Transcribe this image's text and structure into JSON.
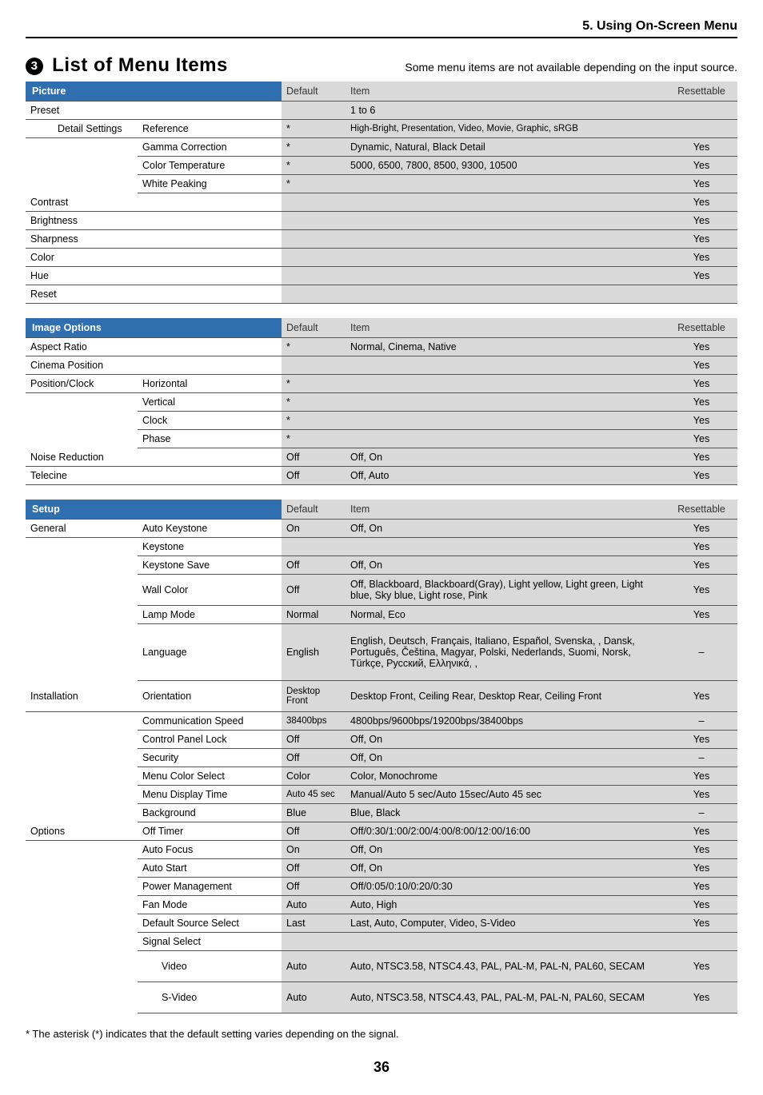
{
  "header": {
    "section": "5. Using On-Screen Menu",
    "bullet": "3",
    "title": "List of Menu Items",
    "subtitle": "Some menu items are not available depending on the input source."
  },
  "columns": {
    "default": "Default",
    "item": "Item",
    "resettable": "Resettable"
  },
  "tables": {
    "picture": {
      "tab": "Picture",
      "rows": [
        {
          "c1": "Preset",
          "c2": "",
          "def": "",
          "item": "1 to 6",
          "res": ""
        },
        {
          "c1": "Detail Settings",
          "c2": "Reference",
          "def": "*",
          "item": "High-Bright, Presentation, Video, Movie, Graphic, sRGB",
          "res": "",
          "indent1": true,
          "small": true
        },
        {
          "c1": "",
          "c2": "Gamma Correction",
          "def": "*",
          "item": "Dynamic, Natural, Black Detail",
          "res": "Yes"
        },
        {
          "c1": "",
          "c2": "Color Temperature",
          "def": "*",
          "item": "5000, 6500, 7800, 8500, 9300, 10500",
          "res": "Yes"
        },
        {
          "c1": "",
          "c2": "White Peaking",
          "def": "*",
          "item": "",
          "res": "Yes"
        },
        {
          "c1": "Contrast",
          "c2": "",
          "def": "",
          "item": "",
          "res": "Yes"
        },
        {
          "c1": "Brightness",
          "c2": "",
          "def": "",
          "item": "",
          "res": "Yes"
        },
        {
          "c1": "Sharpness",
          "c2": "",
          "def": "",
          "item": "",
          "res": "Yes"
        },
        {
          "c1": "Color",
          "c2": "",
          "def": "",
          "item": "",
          "res": "Yes"
        },
        {
          "c1": "Hue",
          "c2": "",
          "def": "",
          "item": "",
          "res": "Yes"
        },
        {
          "c1": "Reset",
          "c2": "",
          "def": "",
          "item": "",
          "res": ""
        }
      ]
    },
    "image": {
      "tab": "Image Options",
      "rows": [
        {
          "c1": "Aspect Ratio",
          "c2": "",
          "def": "*",
          "item": "Normal, Cinema, Native",
          "res": "Yes"
        },
        {
          "c1": "Cinema Position",
          "c2": "",
          "def": "",
          "item": "",
          "res": "Yes"
        },
        {
          "c1": "Position/Clock",
          "c2": "Horizontal",
          "def": "*",
          "item": "",
          "res": "Yes"
        },
        {
          "c1": "",
          "c2": "Vertical",
          "def": "*",
          "item": "",
          "res": "Yes"
        },
        {
          "c1": "",
          "c2": "Clock",
          "def": "*",
          "item": "",
          "res": "Yes"
        },
        {
          "c1": "",
          "c2": "Phase",
          "def": "*",
          "item": "",
          "res": "Yes"
        },
        {
          "c1": "Noise Reduction",
          "c2": "",
          "def": "Off",
          "item": "Off, On",
          "res": "Yes"
        },
        {
          "c1": "Telecine",
          "c2": "",
          "def": "Off",
          "item": "Off, Auto",
          "res": "Yes"
        }
      ]
    },
    "setup": {
      "tab": "Setup",
      "rows": [
        {
          "c1": "General",
          "c2": "Auto Keystone",
          "def": "On",
          "item": "Off, On",
          "res": "Yes"
        },
        {
          "c1": "",
          "c2": "Keystone",
          "def": "",
          "item": "",
          "res": "Yes"
        },
        {
          "c1": "",
          "c2": "Keystone Save",
          "def": "Off",
          "item": "Off, On",
          "res": "Yes"
        },
        {
          "c1": "",
          "c2": "Wall Color",
          "def": "Off",
          "item": "Off, Blackboard, Blackboard(Gray), Light yellow, Light green, Light blue, Sky blue, Light rose, Pink",
          "res": "Yes",
          "tall": true
        },
        {
          "c1": "",
          "c2": "Lamp Mode",
          "def": "Normal",
          "item": "Normal, Eco",
          "res": "Yes"
        },
        {
          "c1": "",
          "c2": "Language",
          "def": "English",
          "item": "English, Deutsch, Français, Italiano, Español, Svenska,            , Dansk, Português, Čeština, Magyar, Polski, Nederlands, Suomi, Norsk, Türkçe, Русский, Еλληνικά,       ,",
          "res": "–",
          "tall4": true
        },
        {
          "c1": "Installation",
          "c2": "Orientation",
          "def": "Desktop Front",
          "defsmall": true,
          "item": "Desktop Front, Ceiling Rear, Desktop Rear, Ceiling Front",
          "res": "Yes",
          "tall": true
        },
        {
          "c1": "",
          "c2": "Communication Speed",
          "def": "38400bps",
          "defsmall": true,
          "item": "4800bps/9600bps/19200bps/38400bps",
          "res": "–"
        },
        {
          "c1": "",
          "c2": "Control Panel Lock",
          "def": "Off",
          "item": "Off, On",
          "res": "Yes"
        },
        {
          "c1": "",
          "c2": "Security",
          "def": "Off",
          "item": "Off, On",
          "res": "–"
        },
        {
          "c1": "",
          "c2": "Menu Color Select",
          "def": "Color",
          "item": "Color, Monochrome",
          "res": "Yes"
        },
        {
          "c1": "",
          "c2": "Menu Display Time",
          "def": "Auto 45 sec",
          "defsmall": true,
          "item": "Manual/Auto 5 sec/Auto 15sec/Auto 45 sec",
          "res": "Yes"
        },
        {
          "c1": "",
          "c2": "Background",
          "def": "Blue",
          "item": "Blue, Black",
          "res": "–"
        },
        {
          "c1": "Options",
          "c2": "Off Timer",
          "def": "Off",
          "item": "Off/0:30/1:00/2:00/4:00/8:00/12:00/16:00",
          "res": "Yes"
        },
        {
          "c1": "",
          "c2": "Auto Focus",
          "def": "On",
          "item": "Off, On",
          "res": "Yes"
        },
        {
          "c1": "",
          "c2": "Auto Start",
          "def": "Off",
          "item": "Off, On",
          "res": "Yes"
        },
        {
          "c1": "",
          "c2": "Power Management",
          "def": "Off",
          "item": "Off/0:05/0:10/0:20/0:30",
          "res": "Yes"
        },
        {
          "c1": "",
          "c2": "Fan Mode",
          "def": "Auto",
          "item": "Auto, High",
          "res": "Yes"
        },
        {
          "c1": "",
          "c2": "Default Source Select",
          "def": "Last",
          "item": "Last, Auto, Computer, Video, S-Video",
          "res": "Yes"
        },
        {
          "c1": "",
          "c2": "Signal Select",
          "def": "",
          "item": "",
          "res": ""
        },
        {
          "c1": "",
          "c2": "Video",
          "indent2": true,
          "def": "Auto",
          "item": "Auto, NTSC3.58, NTSC4.43, PAL, PAL-M, PAL-N, PAL60, SECAM",
          "res": "Yes",
          "tall": true
        },
        {
          "c1": "",
          "c2": "S-Video",
          "indent2": true,
          "def": "Auto",
          "item": "Auto, NTSC3.58, NTSC4.43, PAL, PAL-M, PAL-N, PAL60, SECAM",
          "res": "Yes",
          "tall": true
        }
      ]
    }
  },
  "footnote": "* The asterisk (*) indicates that the default setting varies depending on the signal.",
  "page": "36"
}
